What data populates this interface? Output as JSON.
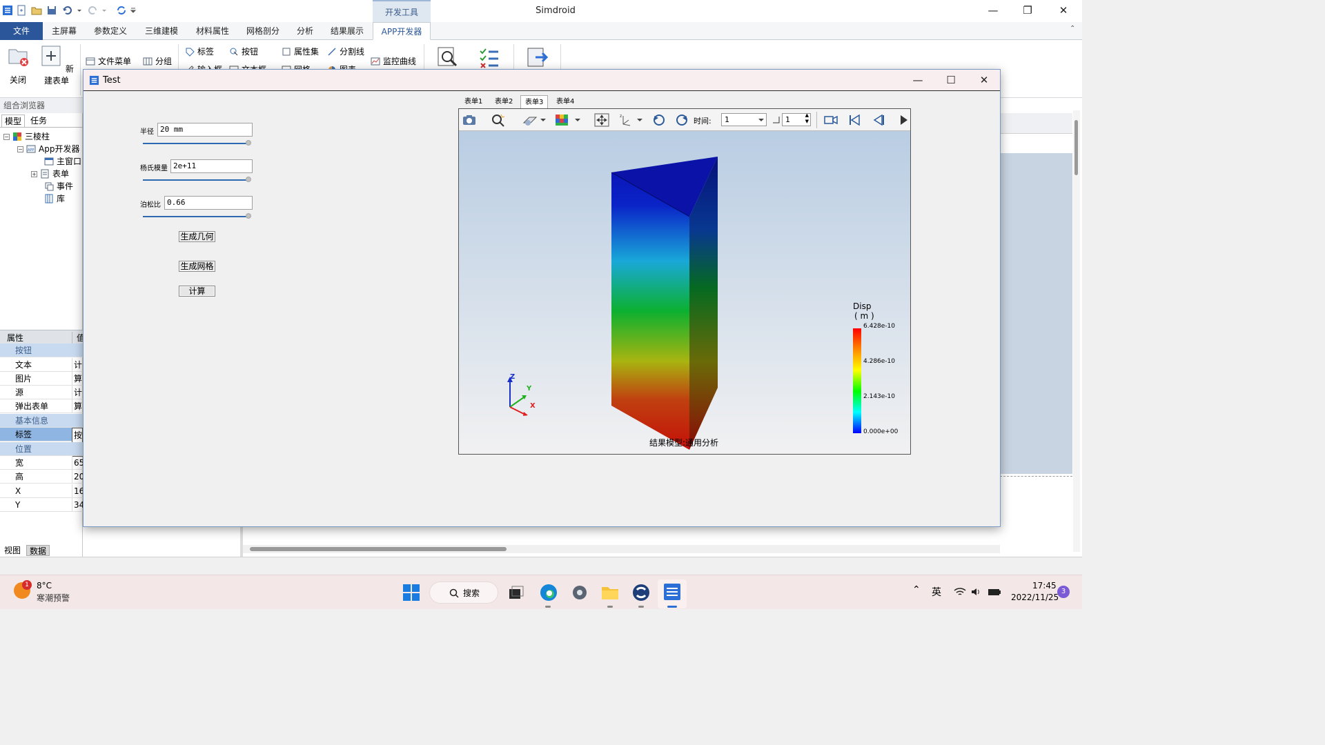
{
  "titlebar": {
    "app_title": "Simdroid",
    "context_tab": "开发工具"
  },
  "ribbon": {
    "tabs": [
      "文件",
      "主屏幕",
      "参数定义",
      "三维建模",
      "材料属性",
      "网格剖分",
      "分析",
      "结果展示",
      "APP开发器"
    ],
    "buttons": {
      "close": "关闭",
      "new_form": "新建表单",
      "file_menu": "文件菜单",
      "group": "分组",
      "label": "标签",
      "button": "按钮",
      "property_set": "属性集",
      "separator": "分割线",
      "monitor_curve": "监控曲线",
      "input_box": "输入框",
      "text_box": "文本框",
      "grid": "网格",
      "chart": "图表"
    }
  },
  "left_panel": {
    "title": "组合浏览器",
    "tabs": [
      "模型",
      "任务"
    ],
    "tree": {
      "root": "三棱柱",
      "app": "App开发器",
      "main_window": "主窗口",
      "forms": "表单",
      "events": "事件",
      "library": "库"
    },
    "props": {
      "header_name": "属性",
      "header_value": "值",
      "rows": [
        {
          "k": "按钮",
          "v": ""
        },
        {
          "k": "文本",
          "v": "计算"
        },
        {
          "k": "图片",
          "v": ""
        },
        {
          "k": "源",
          "v": "计算"
        },
        {
          "k": "弹出表单",
          "v": ""
        },
        {
          "k": "基本信息",
          "v": ""
        },
        {
          "k": "标签",
          "v": "按钮"
        },
        {
          "k": "位置",
          "v": ""
        },
        {
          "k": "宽",
          "v": "65"
        },
        {
          "k": "高",
          "v": "20"
        },
        {
          "k": "X",
          "v": "16"
        },
        {
          "k": "Y",
          "v": "34"
        }
      ]
    },
    "bottom_tabs": [
      "视图",
      "数据"
    ]
  },
  "dialog": {
    "title": "Test",
    "fields": {
      "radius_label": "半径",
      "radius_value": "20 mm",
      "radius_slider": 1.0,
      "modulus_label": "杨氏模量",
      "modulus_value": "2e+11",
      "modulus_slider": 1.0,
      "poisson_label": "泊松比",
      "poisson_value": "0.66",
      "poisson_slider": 1.0
    },
    "buttons": {
      "gen_geometry": "生成几何",
      "gen_mesh": "生成网格",
      "compute": "计算"
    },
    "viewer": {
      "tabs": [
        "表单1",
        "表单2",
        "表单3",
        "表单4"
      ],
      "active_tab": "表单3",
      "time_label": "时间:",
      "time_value": "1",
      "step_value": "1",
      "caption": "结果模型:通用分析",
      "legend": {
        "title": "Disp",
        "unit": "( m )",
        "ticks": [
          "6.428e-10",
          "4.286e-10",
          "2.143e-10",
          "0.000e+00"
        ]
      },
      "axes": {
        "x": "X",
        "y": "Y",
        "z": "Z"
      }
    }
  },
  "taskbar": {
    "weather_temp": "8°C",
    "weather_text": "寒潮预警",
    "weather_badge": "1",
    "search": "搜索",
    "ime": "英",
    "time": "17:45",
    "date": "2022/11/25",
    "notification_count": "3"
  }
}
